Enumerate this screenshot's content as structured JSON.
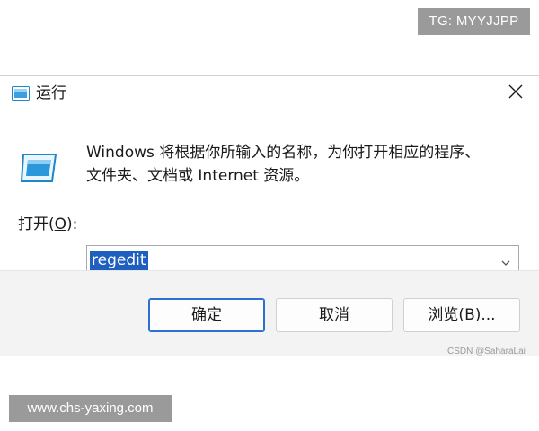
{
  "watermark_top": "TG: MYYJJPP",
  "watermark_bottom": "www.chs-yaxing.com",
  "csdn_mark": "CSDN @SaharaLai",
  "dialog": {
    "title": "运行",
    "title_icon": "run-icon",
    "close_icon": "close-icon",
    "description_line1": "Windows 将根据你所输入的名称，为你打开相应的程序、",
    "description_line2": "文件夹、文档或 Internet 资源。",
    "open_label_prefix": "打开(",
    "open_label_accel": "O",
    "open_label_suffix": "):",
    "input_value": "regedit",
    "buttons": {
      "ok": "确定",
      "cancel": "取消",
      "browse_prefix": "浏览(",
      "browse_accel": "B",
      "browse_suffix": ")..."
    }
  },
  "colors": {
    "accent": "#2f6fcf",
    "selection": "#1f5fbf",
    "footer_bg": "#f3f3f3",
    "watermark_bg": "#9a9a9a"
  }
}
